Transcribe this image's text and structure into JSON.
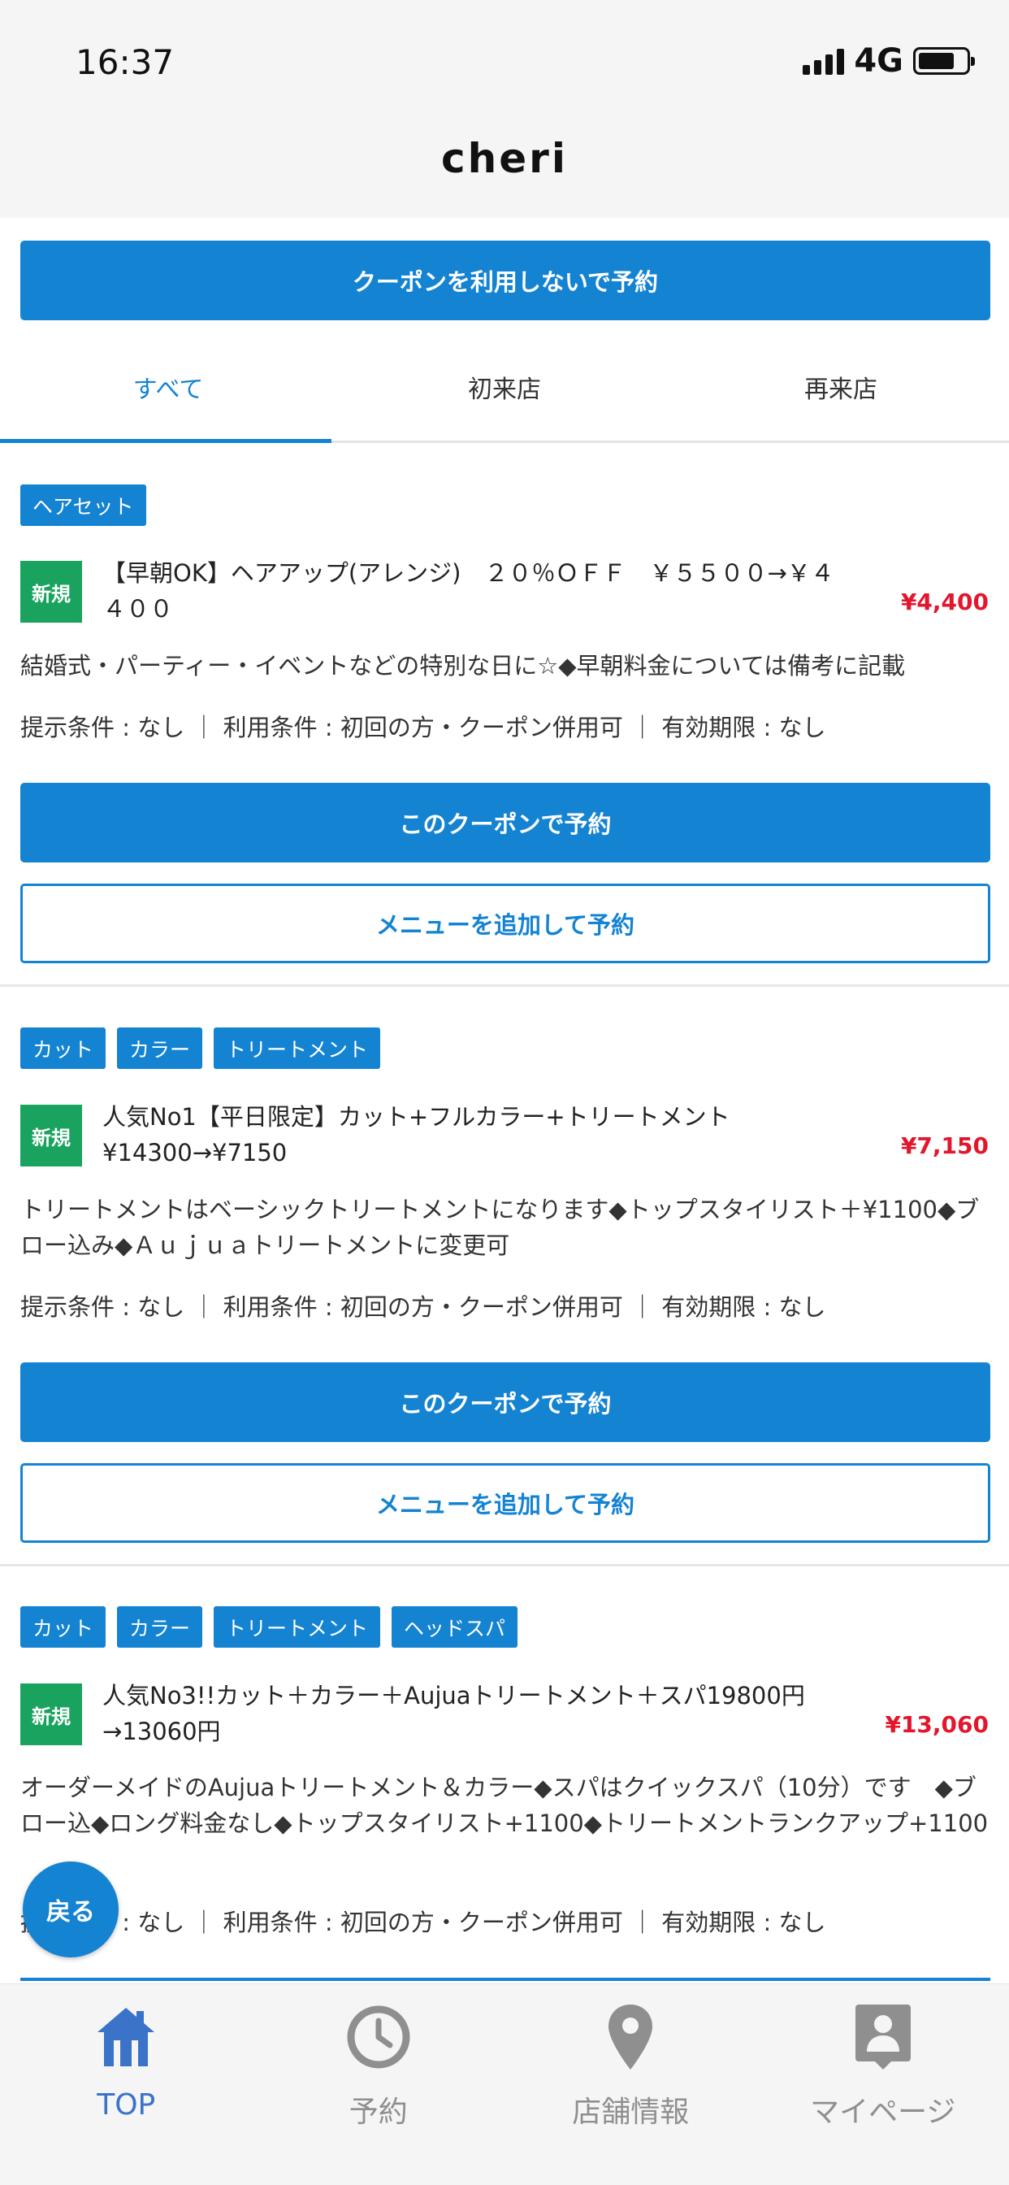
{
  "status_bar": {
    "time": "16:37",
    "network": "4G"
  },
  "header": {
    "title": "cheri"
  },
  "top_cta": "クーポンを利用しないで予約",
  "tabs": [
    {
      "label": "すべて",
      "active": true
    },
    {
      "label": "初来店",
      "active": false
    },
    {
      "label": "再来店",
      "active": false
    }
  ],
  "coupons": [
    {
      "tags": [
        "ヘアセット"
      ],
      "badge": "新規",
      "title": "【早朝OK】ヘアアップ(アレンジ)　２０％ＯＦＦ　￥５５００→￥４４００",
      "price": "¥4,400",
      "description": "結婚式・パーティー・イベントなどの特別な日に☆◆早朝料金については備考に記載",
      "conditions": "提示条件 : なし ｜ 利用条件 : 初回の方・クーポン併用可 ｜ 有効期限 : なし",
      "reserve_label": "このクーポンで予約",
      "add_menu_label": "メニューを追加して予約"
    },
    {
      "tags": [
        "カット",
        "カラー",
        "トリートメント"
      ],
      "badge": "新規",
      "title": "人気No1【平日限定】カット+フルカラー+トリートメント　¥14300→¥7150",
      "price": "¥7,150",
      "description": "トリートメントはベーシックトリートメントになります◆トップスタイリスト＋¥1100◆ブロー込み◆Ａｕｊｕａトリートメントに変更可",
      "conditions": "提示条件 : なし ｜ 利用条件 : 初回の方・クーポン併用可 ｜ 有効期限 : なし",
      "reserve_label": "このクーポンで予約",
      "add_menu_label": "メニューを追加して予約"
    },
    {
      "tags": [
        "カット",
        "カラー",
        "トリートメント",
        "ヘッドスパ"
      ],
      "badge": "新規",
      "title": "人気No3!!カット＋カラー＋Aujuaトリートメント＋スパ19800円→13060円",
      "price": "¥13,060",
      "description": "オーダーメイドのAujuaトリートメント＆カラー◆スパはクイックスパ（10分）です　◆ブロー込◆ロング料金なし◆トップスタイリスト+1100◆トリートメントランクアップ+1100",
      "conditions": "提示条件 : なし ｜ 利用条件 : 初回の方・クーポン併用可 ｜ 有効期限 : なし"
    }
  ],
  "back_button": "戻る",
  "bottom_nav": [
    {
      "label": "TOP",
      "icon": "home-icon",
      "active": true
    },
    {
      "label": "予約",
      "icon": "clock-icon",
      "active": false
    },
    {
      "label": "店舗情報",
      "icon": "location-pin-icon",
      "active": false
    },
    {
      "label": "マイページ",
      "icon": "user-card-icon",
      "active": false
    }
  ],
  "colors": {
    "accent": "#1483d2",
    "price": "#e2162d",
    "badge": "#1aa35e",
    "nav_active": "#3a73c8"
  }
}
